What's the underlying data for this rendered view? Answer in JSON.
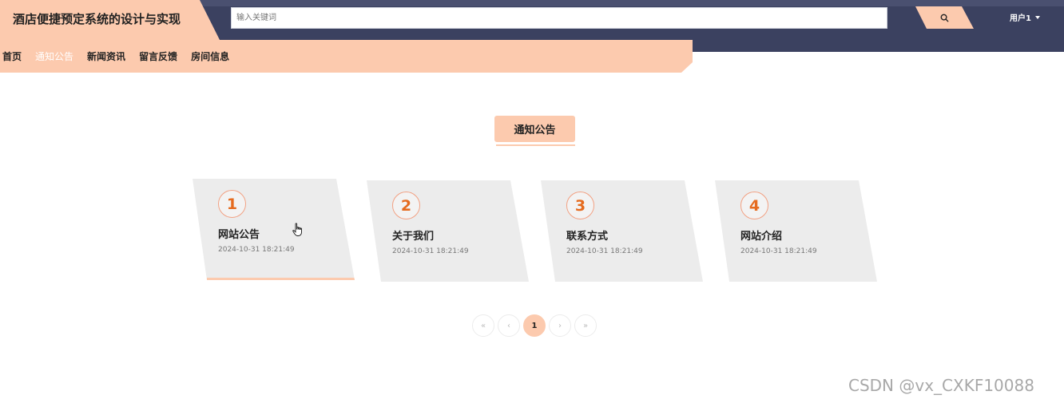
{
  "app": {
    "title": "酒店便捷预定系统的设计与实现"
  },
  "search": {
    "placeholder": "输入关键词",
    "value": ""
  },
  "header": {
    "user_label": "用户1",
    "search_icon": "search-icon",
    "caret_icon": "caret-down-icon"
  },
  "nav": {
    "items": [
      {
        "label": "首页",
        "active": false
      },
      {
        "label": "通知公告",
        "active": true
      },
      {
        "label": "新闻资讯",
        "active": false
      },
      {
        "label": "留言反馈",
        "active": false
      },
      {
        "label": "房间信息",
        "active": false
      }
    ]
  },
  "section": {
    "title": "通知公告"
  },
  "notices": [
    {
      "number": "1",
      "title": "网站公告",
      "date": "2024-10-31 18:21:49"
    },
    {
      "number": "2",
      "title": "关于我们",
      "date": "2024-10-31 18:21:49"
    },
    {
      "number": "3",
      "title": "联系方式",
      "date": "2024-10-31 18:21:49"
    },
    {
      "number": "4",
      "title": "网站介绍",
      "date": "2024-10-31 18:21:49"
    }
  ],
  "pagination": {
    "first": "«",
    "prev": "‹",
    "current": "1",
    "next": "›",
    "last": "»"
  },
  "watermark": "CSDN @vx_CXKF10088",
  "colors": {
    "accent": "#fccaae",
    "header_bg": "#3b4160",
    "card_bg": "#ececec",
    "number": "#e56b1f"
  }
}
